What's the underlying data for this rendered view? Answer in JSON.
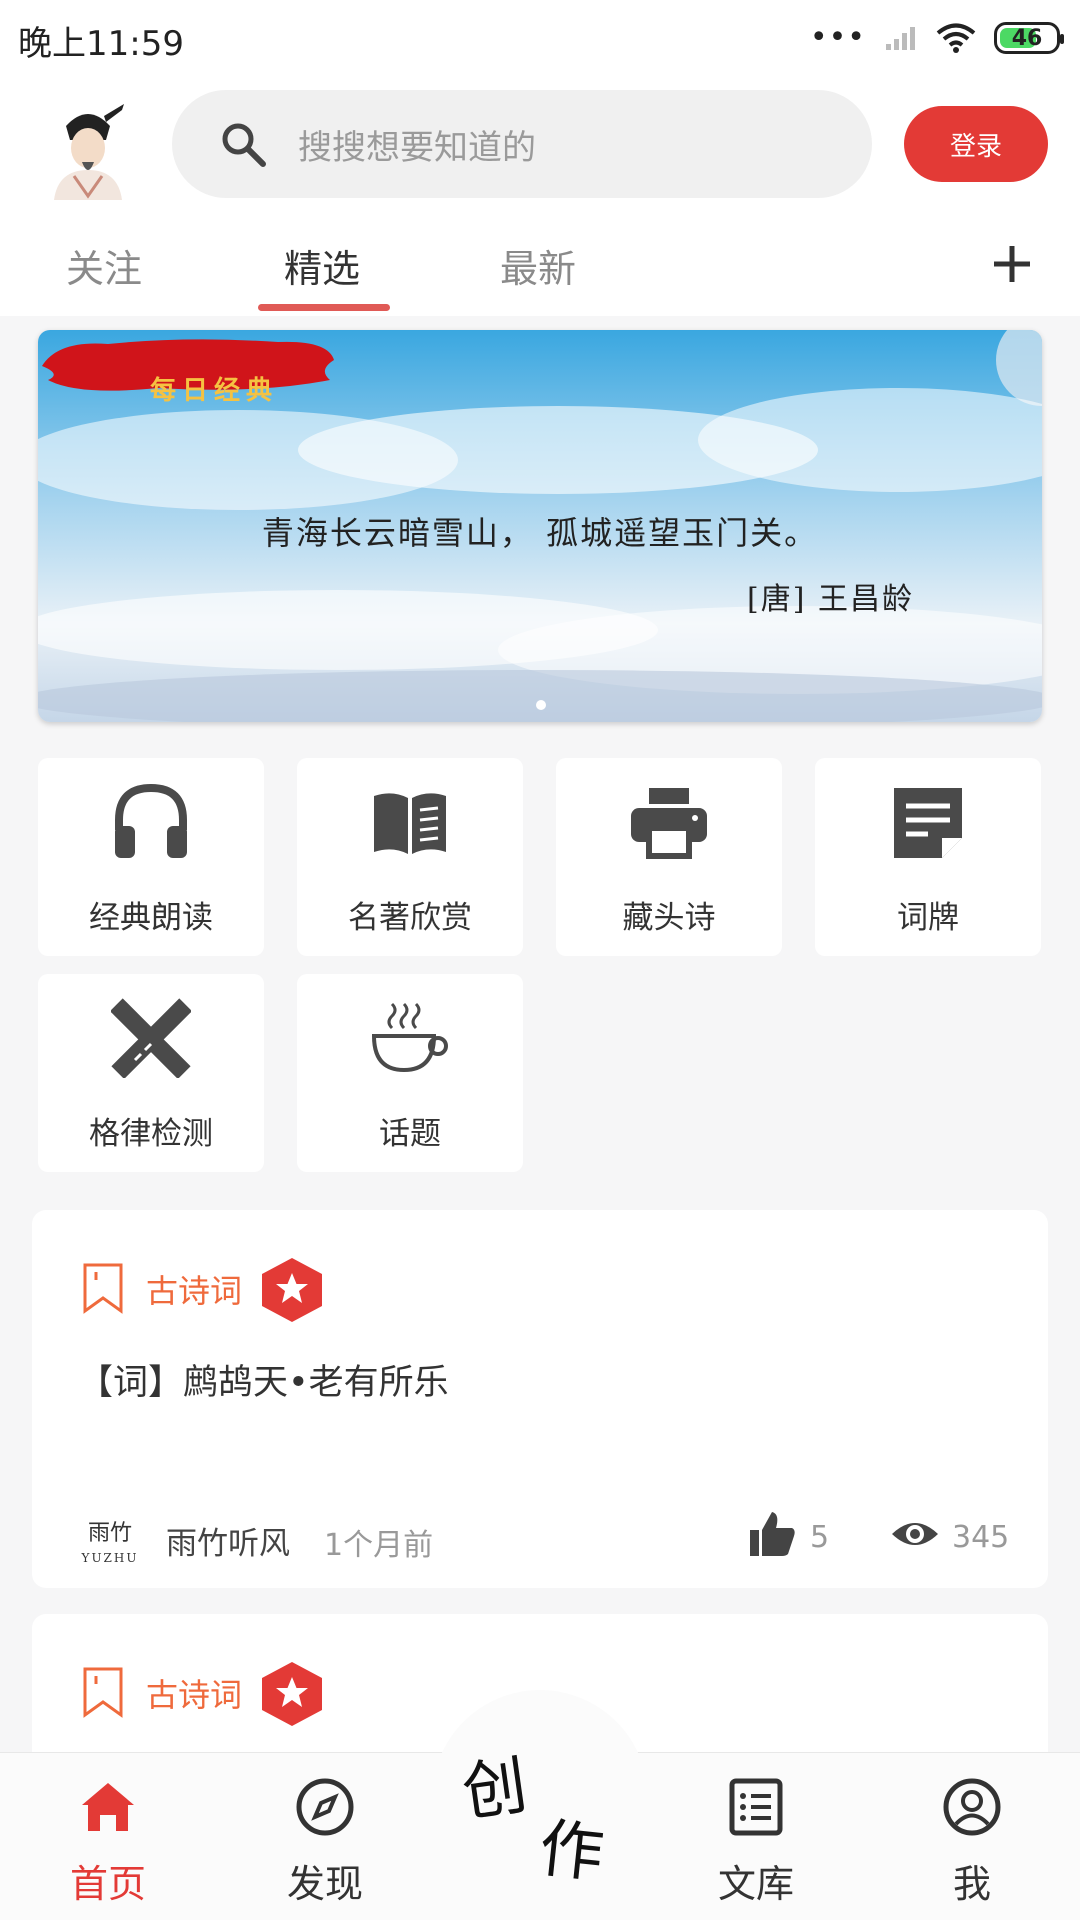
{
  "status_bar": {
    "time": "晚上11:59",
    "signal_dots": "•••",
    "battery": "46"
  },
  "header": {
    "search_placeholder": "搜搜想要知道的",
    "login_label": "登录",
    "tabs": [
      {
        "label": "关注"
      },
      {
        "label": "精选",
        "active": true
      },
      {
        "label": "最新"
      }
    ]
  },
  "banner": {
    "badge": "每日经典",
    "line": "青海长云暗雪山， 孤城遥望玉门关。",
    "author": "[唐] 王昌龄"
  },
  "features": [
    {
      "label": "经典朗读",
      "icon": "headphones-icon"
    },
    {
      "label": "名著欣赏",
      "icon": "book-icon"
    },
    {
      "label": "藏头诗",
      "icon": "printer-icon"
    },
    {
      "label": "词牌",
      "icon": "note-icon"
    },
    {
      "label": "格律检测",
      "icon": "ruler-pencil-icon"
    },
    {
      "label": "话题",
      "icon": "coffee-cup-icon"
    }
  ],
  "posts": [
    {
      "tag": "古诗词",
      "title": "【词】鹧鸪天•老有所乐",
      "author_logo": "雨竹",
      "author_logo_sub": "YUZHU",
      "author": "雨竹听风",
      "time": "1个月前",
      "likes": "5",
      "views": "345"
    },
    {
      "tag": "古诗词"
    }
  ],
  "bottom_nav": {
    "items": [
      {
        "label": "首页",
        "icon": "home-icon",
        "active": true
      },
      {
        "label": "发现",
        "icon": "compass-icon"
      },
      {
        "label": "文库",
        "icon": "list-icon"
      },
      {
        "label": "我",
        "icon": "user-icon"
      }
    ],
    "create_char1": "创",
    "create_char2": "作"
  },
  "colors": {
    "accent": "#e33a36",
    "tag": "#ef6a3c",
    "icon": "#4a4a4a"
  }
}
